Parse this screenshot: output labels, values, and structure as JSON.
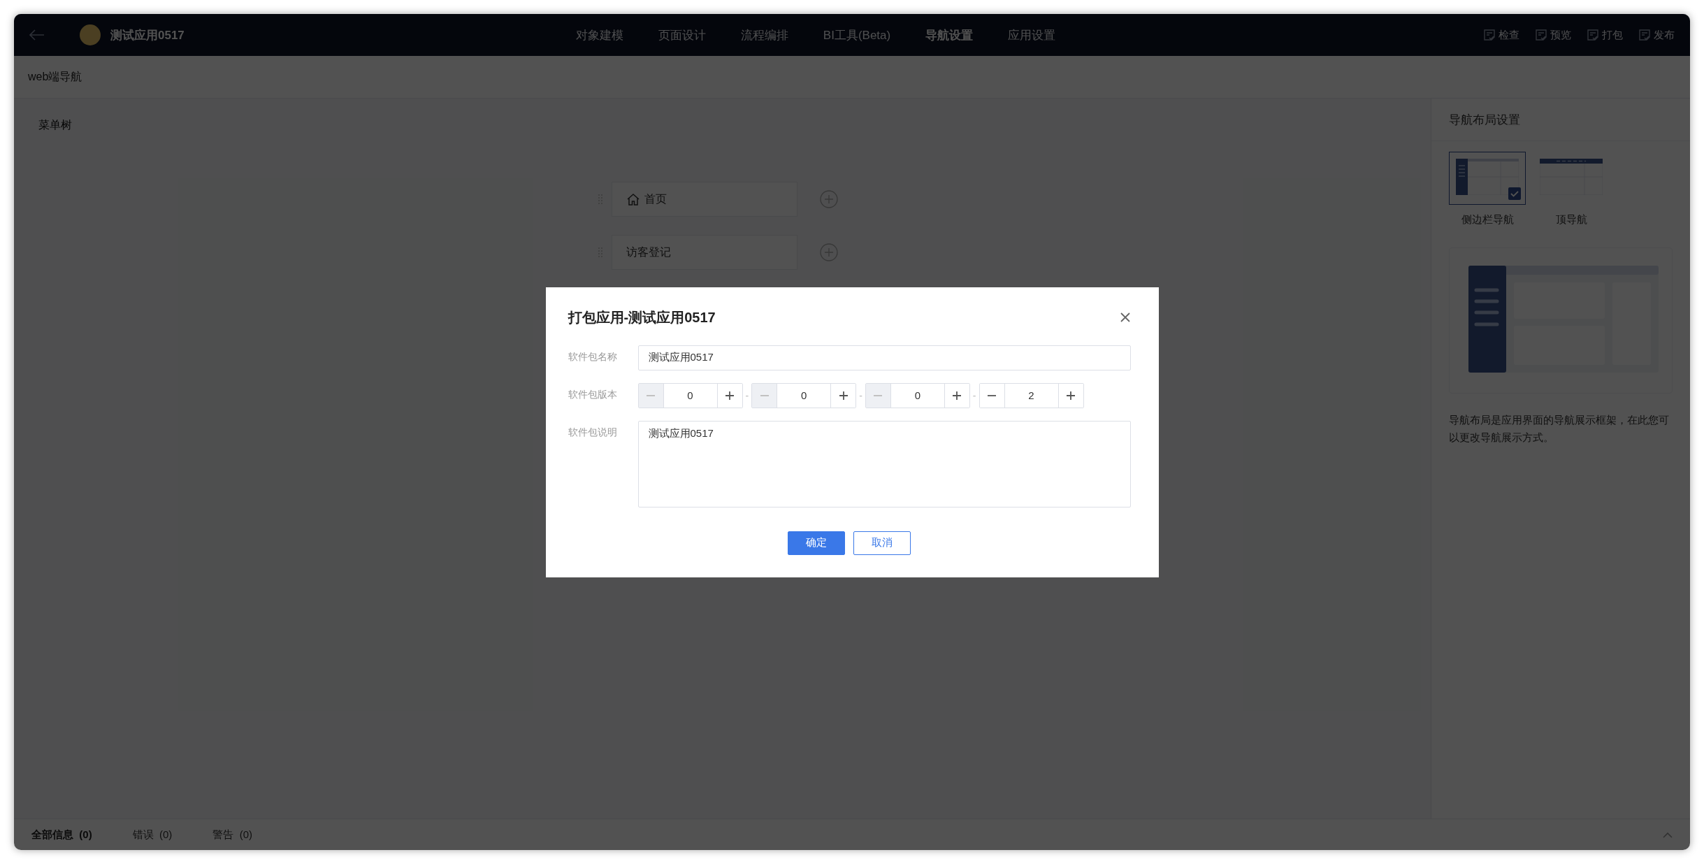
{
  "header": {
    "app_name": "测试应用0517",
    "tabs": [
      {
        "label": "对象建模",
        "selected": false
      },
      {
        "label": "页面设计",
        "selected": false
      },
      {
        "label": "流程编排",
        "selected": false
      },
      {
        "label": "BI工具(Beta)",
        "selected": false
      },
      {
        "label": "导航设置",
        "selected": true
      },
      {
        "label": "应用设置",
        "selected": false
      }
    ],
    "actions": [
      "检查",
      "预览",
      "打包",
      "发布"
    ]
  },
  "subheader": {
    "title": "web端导航"
  },
  "menu_tree": {
    "title": "菜单树",
    "items": [
      {
        "label": "首页",
        "kind": "home"
      },
      {
        "label": "访客登记",
        "kind": "page"
      }
    ]
  },
  "layout_panel": {
    "title": "导航布局设置",
    "options": [
      {
        "label": "侧边栏导航",
        "kind": "sidebar",
        "selected": true
      },
      {
        "label": "顶导航",
        "kind": "top",
        "selected": false
      }
    ],
    "description": "导航布局是应用界面的导航展示框架，在此您可以更改导航展示方式。"
  },
  "bottom_tabs": [
    {
      "label": "全部信息",
      "count": "(0)",
      "selected": true
    },
    {
      "label": "错误",
      "count": "(0)",
      "selected": false
    },
    {
      "label": "警告",
      "count": "(0)",
      "selected": false
    }
  ],
  "dialog": {
    "title": "打包应用-测试应用0517",
    "name_label": "软件包名称",
    "name_value": "测试应用0517",
    "version_label": "软件包版本",
    "version_parts": [
      {
        "value": "0",
        "minus_disabled": true
      },
      {
        "value": "0",
        "minus_disabled": true
      },
      {
        "value": "0",
        "minus_disabled": true
      },
      {
        "value": "2",
        "minus_disabled": false
      }
    ],
    "separator": "-",
    "desc_label": "软件包说明",
    "desc_value": "测试应用0517",
    "buttons": [
      {
        "label": "确定",
        "kind": "primary"
      },
      {
        "label": "取消",
        "kind": "secondary"
      }
    ]
  }
}
